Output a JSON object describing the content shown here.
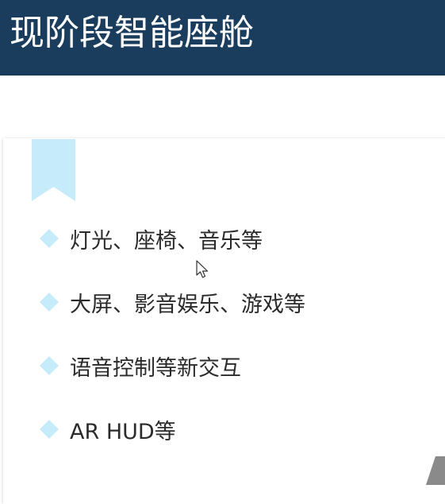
{
  "header": {
    "title": "现阶段智能座舱",
    "background": "#1a3d5e"
  },
  "bullets": [
    {
      "icon": "diamond-bullet-icon",
      "text": "灯光、座椅、音乐等"
    },
    {
      "icon": "diamond-bullet-icon",
      "text": "大屏、影音娱乐、游戏等"
    },
    {
      "icon": "diamond-bullet-icon",
      "text": "语音控制等新交互"
    },
    {
      "icon": "diamond-bullet-icon",
      "text": "AR HUD等"
    }
  ],
  "colors": {
    "accent": "#c6ebfb",
    "text": "#2b2b2b"
  },
  "icons": {
    "ribbon": "bookmark-ribbon-icon",
    "cursor": "mouse-cursor-icon"
  }
}
